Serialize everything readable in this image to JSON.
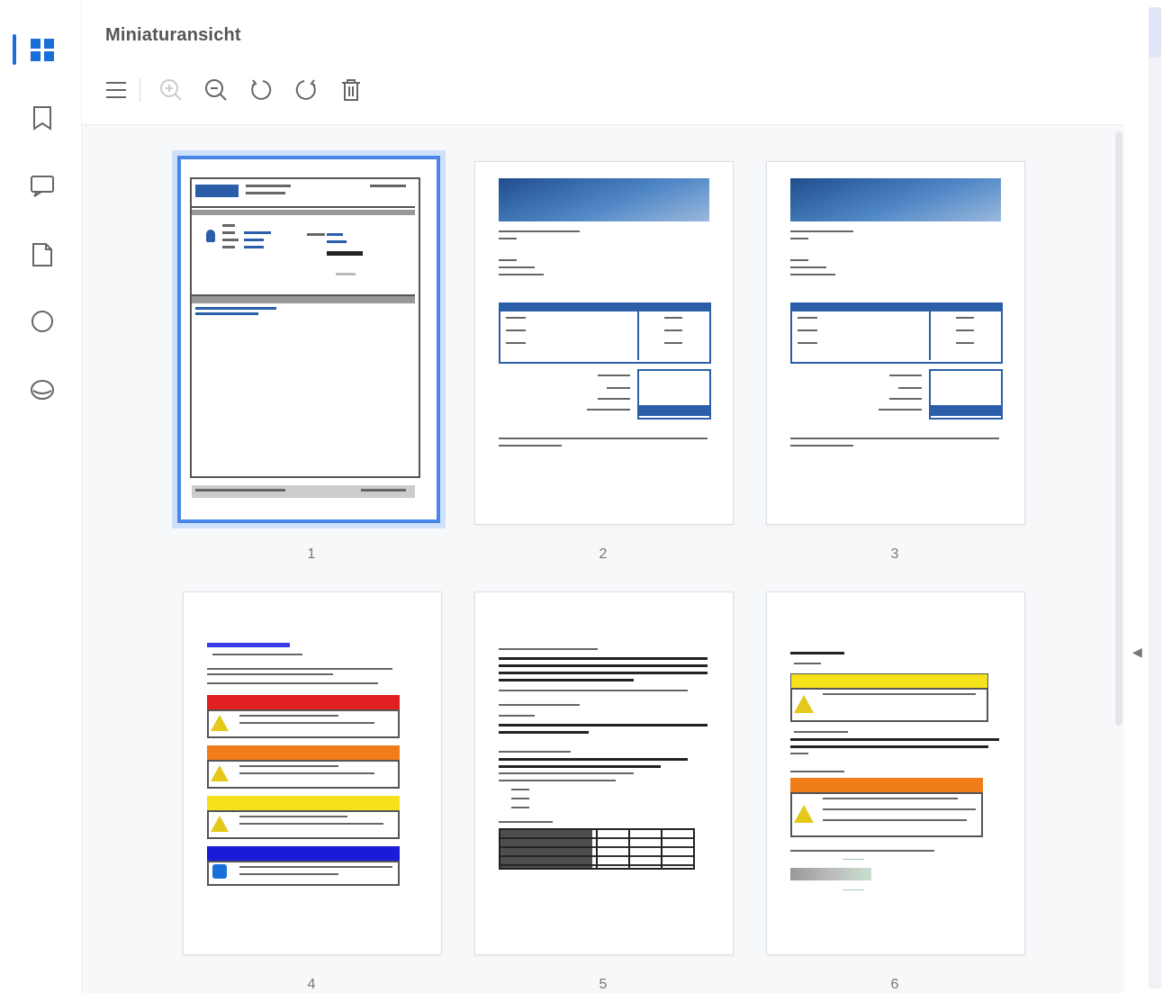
{
  "panel": {
    "title": "Miniaturansicht"
  },
  "rail": {
    "items": [
      {
        "name": "thumbnails-icon",
        "active": true
      },
      {
        "name": "bookmark-icon",
        "active": false
      },
      {
        "name": "comment-icon",
        "active": false
      },
      {
        "name": "attachment-icon",
        "active": false
      },
      {
        "name": "layers-icon",
        "active": false
      },
      {
        "name": "signature-icon",
        "active": false
      }
    ]
  },
  "toolbar": {
    "items": [
      "menu-icon",
      "zoom-in-icon",
      "zoom-out-icon",
      "rotate-left-icon",
      "rotate-right-icon",
      "delete-icon"
    ]
  },
  "thumbnails": [
    {
      "number": "1",
      "selected": true
    },
    {
      "number": "2",
      "selected": false
    },
    {
      "number": "3",
      "selected": false
    },
    {
      "number": "4",
      "selected": false
    },
    {
      "number": "5",
      "selected": false
    },
    {
      "number": "6",
      "selected": false
    }
  ],
  "colors": {
    "accent": "#1a6ed8",
    "selection": "#4a86e8",
    "header_blue": "#2b5ea8",
    "danger": "#e02020",
    "warning_orange": "#f07c1a",
    "caution_yellow": "#f5e21a",
    "notice_blue": "#1a1ad8"
  }
}
